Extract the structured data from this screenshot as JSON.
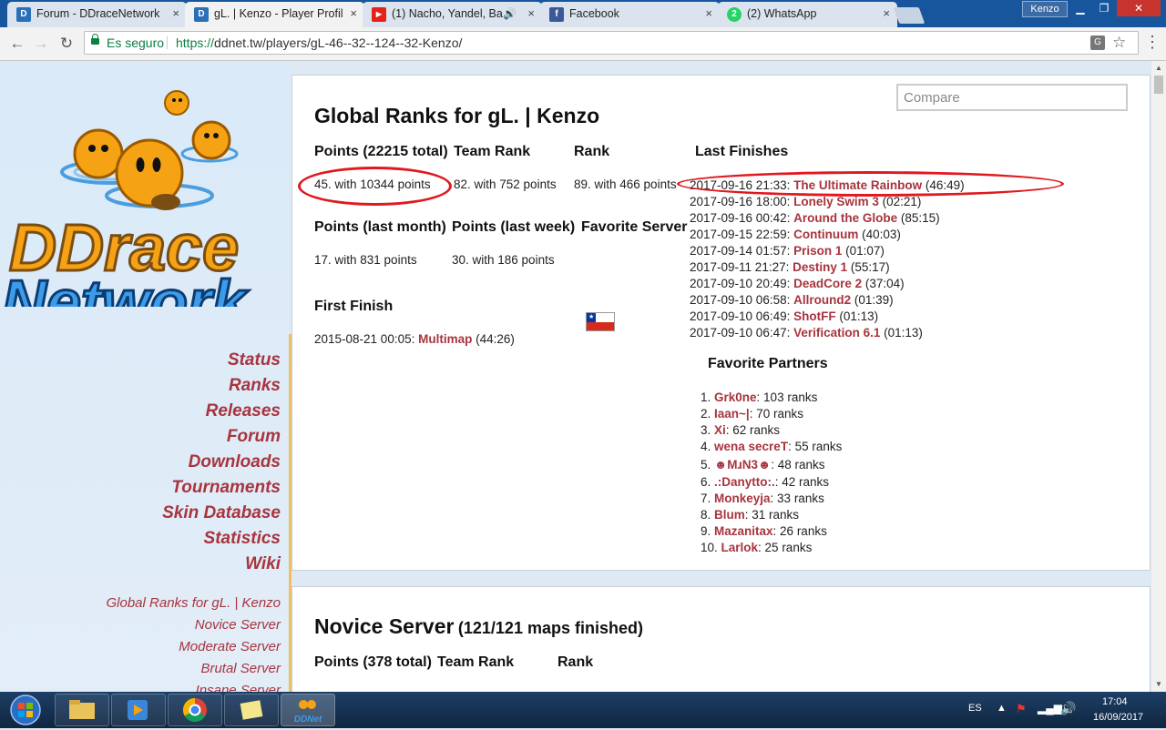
{
  "browser": {
    "tabs": [
      {
        "title": "Forum - DDraceNetwork",
        "favicon": "ddnet-icon",
        "close": "×"
      },
      {
        "title": "gL. | Kenzo - Player Profil",
        "favicon": "ddnet-icon",
        "close": "×"
      },
      {
        "title": "(1) Nacho, Yandel, Ba",
        "favicon": "youtube-icon",
        "sound": "🔊",
        "close": "×"
      },
      {
        "title": "Facebook",
        "favicon": "facebook-icon",
        "close": "×"
      },
      {
        "title": "(2) WhatsApp",
        "favicon": "whatsapp-icon",
        "whatsapp_badge": "2",
        "close": "×"
      }
    ],
    "user": "Kenzo",
    "address": {
      "secure_label": "Es seguro",
      "scheme": "https://",
      "url": "ddnet.tw/players/gL-46--32--124--32-Kenzo/"
    }
  },
  "sidebar": {
    "logo_line1": "DDrace",
    "logo_line2": "Network",
    "nav": [
      "Status",
      "Ranks",
      "Releases",
      "Forum",
      "Downloads",
      "Tournaments",
      "Skin Database",
      "Statistics",
      "Wiki"
    ],
    "subnav": [
      "Global Ranks for gL. | Kenzo",
      "Novice Server",
      "Moderate Server",
      "Brutal Server",
      "Insane Server"
    ]
  },
  "global": {
    "compare_placeholder": "Compare",
    "title": "Global Ranks for gL. | Kenzo",
    "points_header": "Points (22215 total)",
    "points_value": "45. with 10344 points",
    "team_rank_header": "Team Rank",
    "team_rank_value": "82. with 752 points",
    "rank_header": "Rank",
    "rank_value": "89. with 466 points",
    "month_header": "Points (last month)",
    "month_value": "17. with 831 points",
    "week_header": "Points (last week)",
    "week_value": "30. with 186 points",
    "fav_server_header": "Favorite Server",
    "first_finish_header": "First Finish",
    "first_finish": {
      "date": "2015-08-21 00:05: ",
      "map": "Multimap",
      "time": " (44:26)"
    },
    "last_finishes_header": "Last Finishes",
    "last_finishes": [
      {
        "date": "2017-09-16 21:33: ",
        "map": "The Ultimate Rainbow",
        "time": " (46:49)"
      },
      {
        "date": "2017-09-16 18:00: ",
        "map": "Lonely Swim 3",
        "time": " (02:21)"
      },
      {
        "date": "2017-09-16 00:42: ",
        "map": "Around the Globe",
        "time": " (85:15)"
      },
      {
        "date": "2017-09-15 22:59: ",
        "map": "Continuum",
        "time": " (40:03)"
      },
      {
        "date": "2017-09-14 01:57: ",
        "map": "Prison 1",
        "time": " (01:07)"
      },
      {
        "date": "2017-09-11 21:27: ",
        "map": "Destiny 1",
        "time": " (55:17)"
      },
      {
        "date": "2017-09-10 20:49: ",
        "map": "DeadCore 2",
        "time": " (37:04)"
      },
      {
        "date": "2017-09-10 06:58: ",
        "map": "Allround2",
        "time": " (01:39)"
      },
      {
        "date": "2017-09-10 06:49: ",
        "map": "ShotFF",
        "time": " (01:13)"
      },
      {
        "date": "2017-09-10 06:47: ",
        "map": "Verification 6.1",
        "time": " (01:13)"
      }
    ],
    "partners_header": "Favorite Partners",
    "partners": [
      {
        "num": "1. ",
        "name": "Grk0ne",
        "ranks": ": 103 ranks"
      },
      {
        "num": "2. ",
        "name": "Iaan~|",
        "ranks": ": 70 ranks"
      },
      {
        "num": "3. ",
        "name": "Xi",
        "ranks": ": 62 ranks"
      },
      {
        "num": "4. ",
        "name": "wena secreT",
        "ranks": ": 55 ranks"
      },
      {
        "num": "5. ",
        "name": "☻MɹN3☻",
        "ranks": ": 48 ranks"
      },
      {
        "num": "6. ",
        "name": ".:Danytto:.",
        "ranks": ": 42 ranks"
      },
      {
        "num": "7. ",
        "name": "Monkeyja",
        "ranks": ": 33 ranks"
      },
      {
        "num": "8. ",
        "name": "Blum",
        "ranks": ": 31 ranks"
      },
      {
        "num": "9. ",
        "name": "Mazanitax",
        "ranks": ": 26 ranks"
      },
      {
        "num": "10. ",
        "name": "Larlok",
        "ranks": ": 25 ranks"
      }
    ]
  },
  "novice": {
    "title": "Novice Server",
    "subtitle": "(121/121 maps finished)",
    "points_header": "Points (378 total)",
    "team_rank_header": "Team Rank",
    "rank_header": "Rank"
  },
  "taskbar": {
    "lang": "ES",
    "time": "17:04",
    "date": "16/09/2017",
    "ddnet_label": "DDNet"
  },
  "colors": {
    "link": "#a7343e",
    "highlight": "#e01920",
    "accent": "#17569d"
  }
}
